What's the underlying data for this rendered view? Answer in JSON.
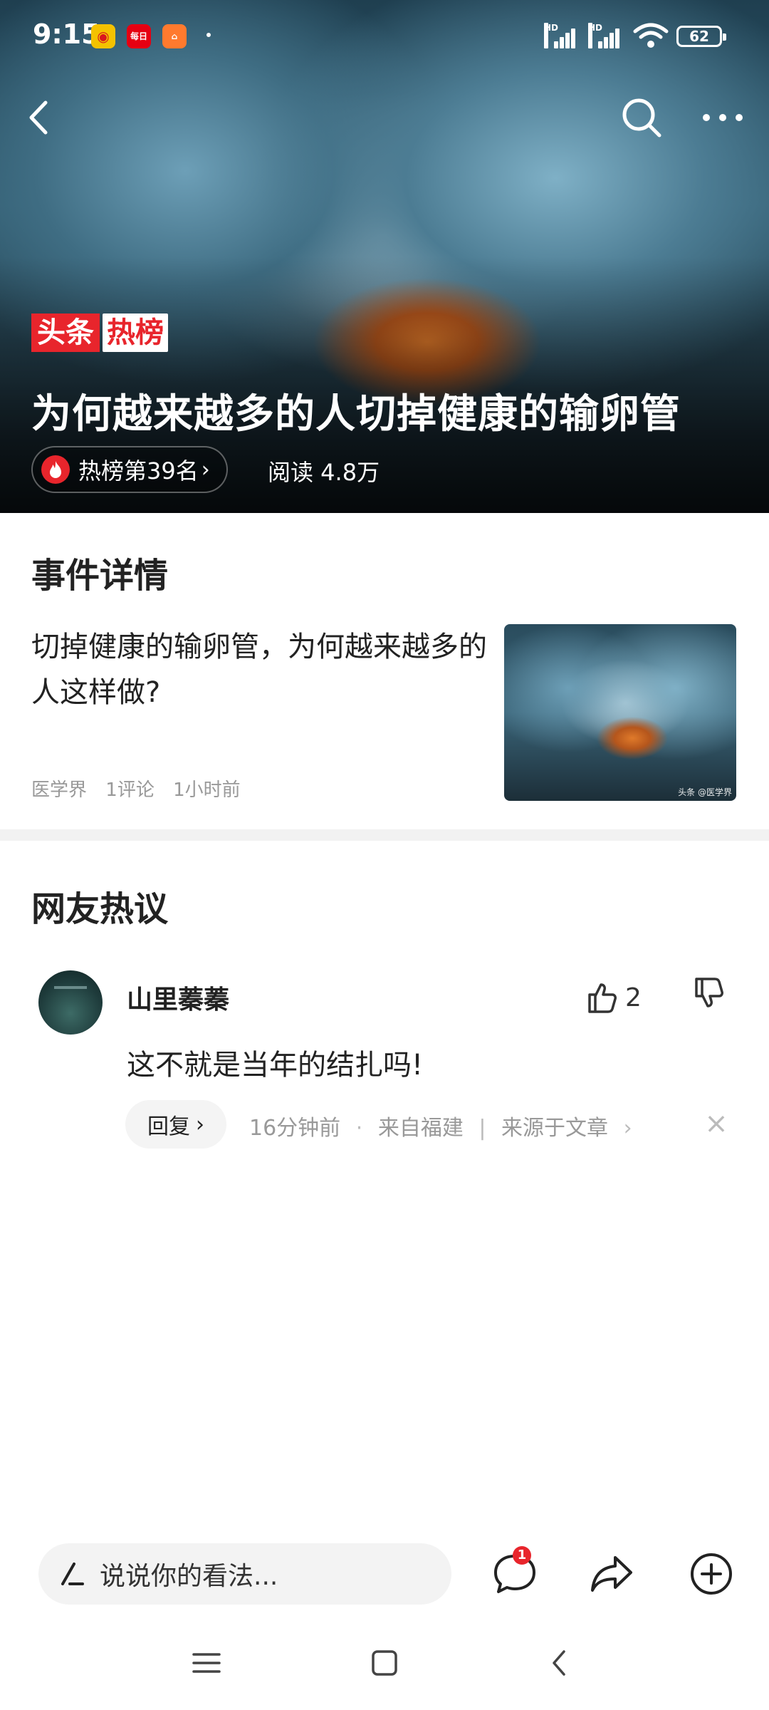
{
  "status_bar": {
    "time": "9:15",
    "battery": "62",
    "hd1": "HD",
    "hd2": "HD",
    "app2_text": "每日"
  },
  "hero": {
    "brand_part1": "头条",
    "brand_part2": "热榜",
    "title": "为何越来越多的人切掉健康的输卵管",
    "rank_label": "热榜第39名",
    "read_label": "阅读 4.8万"
  },
  "event": {
    "section_title": "事件详情",
    "headline": "切掉健康的输卵管，为何越来越多的人这样做?",
    "source": "医学界",
    "comments": "1评论",
    "time": "1小时前",
    "thumb_watermark": "头条 @医学界"
  },
  "comments": {
    "section_title": "网友热议",
    "items": [
      {
        "user": "山里蓁蓁",
        "likes": "2",
        "text": "这不就是当年的结扎吗!",
        "reply_label": "回复",
        "time": "16分钟前",
        "location": "来自福建",
        "source": "来源于文章"
      }
    ]
  },
  "bottom_bar": {
    "input_placeholder": "说说你的看法...",
    "comment_badge": "1"
  },
  "colors": {
    "accent_red": "#e8252c",
    "meta_gray": "#999999",
    "divider": "#f2f2f2"
  }
}
